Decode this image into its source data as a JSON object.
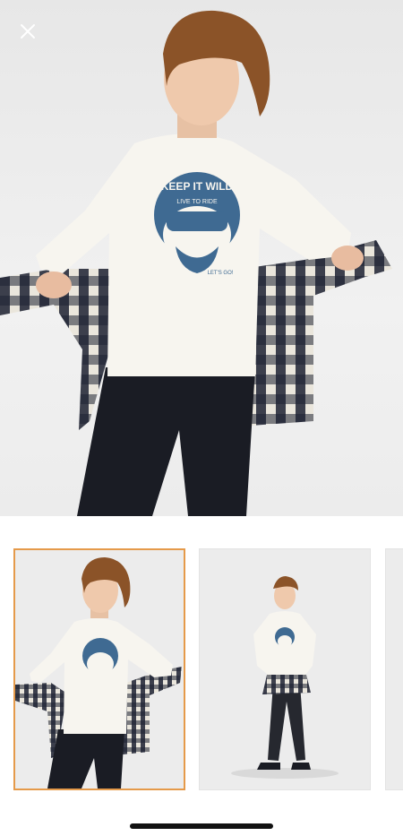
{
  "hero": {
    "image": "boy-in-white-long-sleeve-tiger-print-tshirt-holding-plaid-shirt",
    "print_text_top": "KEEP IT WILD",
    "print_text_sub": "LIVE TO RIDE",
    "print_text_tag": "LET'S GO!"
  },
  "close": {
    "icon": "close-icon"
  },
  "thumbnails": [
    {
      "image": "front-view-boy-holding-plaid-shirt",
      "selected": true
    },
    {
      "image": "full-body-boy-with-plaid-shirt-tied-at-waist",
      "selected": false
    },
    {
      "image": "partial-next-thumbnail",
      "selected": false
    }
  ],
  "colors": {
    "selected_border": "#e59a4a",
    "print_blue": "#3f6a92",
    "background": "#ececec"
  }
}
